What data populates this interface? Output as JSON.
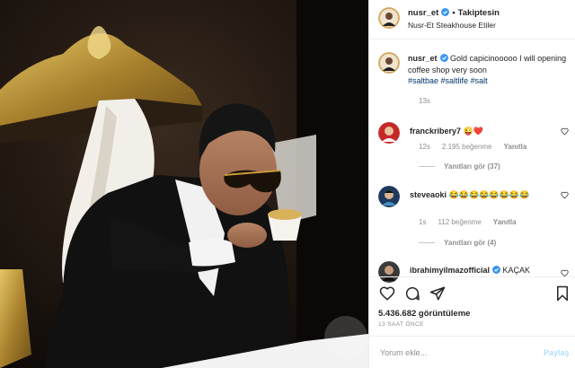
{
  "post": {
    "author": "nusr_et",
    "follow_status": "Takiptesin",
    "location": "Nusr-Et Steakhouse Etiler"
  },
  "caption": {
    "user": "nusr_et",
    "text": "Gold capicinooooo I will opening coffee shop very soon",
    "hashtags": [
      "#saltbae",
      "#saltlife",
      "#salt"
    ],
    "time": "13s"
  },
  "comments": [
    {
      "user": "franckribery7",
      "emojis": "😜❤️",
      "time": "12s",
      "likes": "2.195 beğenme",
      "reply_label": "Yanıtla",
      "view_replies": "Yanıtları gör (37)"
    },
    {
      "user": "steveaoki",
      "emojis": "😂😂😂😂😂😂😂😂",
      "time": "1s",
      "likes": "112 beğenme",
      "reply_label": "Yanıtla",
      "view_replies": "Yanıtları gör (4)"
    },
    {
      "user": "ibrahimyilmazofficial",
      "text": "KAÇAK"
    }
  ],
  "actions": {
    "views": "5.436.682 görüntüleme",
    "posted_ago": "13 SAAT ÖNCE"
  },
  "add_comment": {
    "placeholder": "Yorum ekle...",
    "post_label": "Paylaş"
  },
  "colors": {
    "link": "#00376b",
    "verified": "#3897f0",
    "muted": "#8e8e8e",
    "post_disabled": "#b2dffc"
  }
}
